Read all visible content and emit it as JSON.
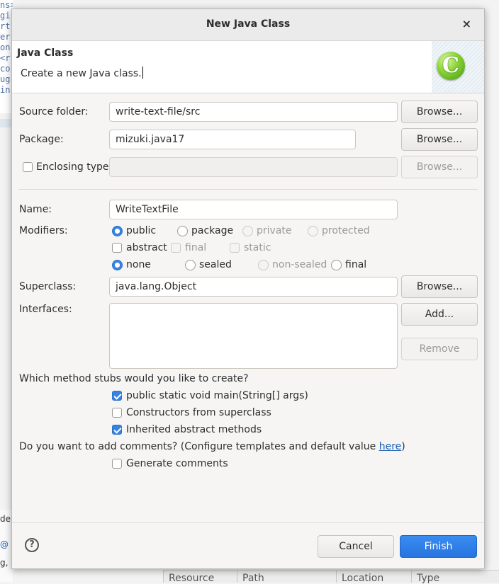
{
  "background": {
    "code_lines": [
      "ns>",
      "gi",
      "rt",
      "er",
      "on",
      "<r",
      "co",
      "ug",
      "in"
    ],
    "left_texts": [
      "de",
      "@",
      "g, C"
    ],
    "table_headers": [
      "Resource",
      "Path",
      "Location",
      "Type"
    ]
  },
  "dialog": {
    "title": "New Java Class",
    "close_glyph": "×",
    "header": {
      "title": "Java Class",
      "description": "Create a new Java class.",
      "logo_letter": "C",
      "logo_color": "#8fd53a"
    },
    "source_folder": {
      "label": "Source folder:",
      "value": "write-text-file/src",
      "button": "Browse..."
    },
    "package": {
      "label": "Package:",
      "value": "mizuki.java17",
      "button": "Browse..."
    },
    "enclosing": {
      "label": "Enclosing type:",
      "value": "",
      "button": "Browse...",
      "checked": false
    },
    "name": {
      "label": "Name:",
      "value": "WriteTextFile"
    },
    "modifiers": {
      "label": "Modifiers:",
      "access": [
        "public",
        "package",
        "private",
        "protected"
      ],
      "access_selected": "public",
      "flags": [
        "abstract",
        "final",
        "static"
      ],
      "inheritance": [
        "none",
        "sealed",
        "non-sealed",
        "final"
      ],
      "inheritance_selected": "none"
    },
    "superclass": {
      "label": "Superclass:",
      "value": "java.lang.Object",
      "button": "Browse..."
    },
    "interfaces": {
      "label": "Interfaces:",
      "add_button": "Add...",
      "remove_button": "Remove"
    },
    "stubs": {
      "question": "Which method stubs would you like to create?",
      "main": "public static void main(String[] args)",
      "constructors": "Constructors from superclass",
      "inherited": "Inherited abstract methods"
    },
    "comments": {
      "question": "Do you want to add comments? (Configure templates and default value ",
      "link": "here",
      "close_paren": ")",
      "generate": "Generate comments"
    },
    "footer": {
      "help_glyph": "?",
      "cancel": "Cancel",
      "finish": "Finish"
    },
    "accent_color": "#3584e4"
  }
}
